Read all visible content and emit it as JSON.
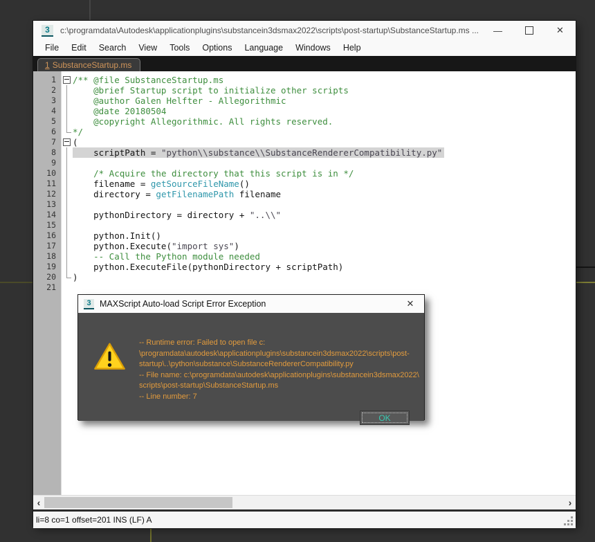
{
  "window": {
    "title": "c:\\programdata\\Autodesk\\applicationplugins\\substancein3dsmax2022\\scripts\\post-startup\\SubstanceStartup.ms ...",
    "minimize_glyph": "—",
    "close_glyph": "✕"
  },
  "icons": {
    "max_logo": "3"
  },
  "menu": {
    "items": [
      "File",
      "Edit",
      "Search",
      "View",
      "Tools",
      "Options",
      "Language",
      "Windows",
      "Help"
    ]
  },
  "tabs": [
    {
      "index": "1",
      "label": "SubstanceStartup.ms",
      "active": true
    }
  ],
  "editor": {
    "lines": [
      {
        "n": 1,
        "fold": "box",
        "hl": false,
        "segments": [
          {
            "c": "comment",
            "t": "/** @file SubstanceStartup.ms"
          }
        ]
      },
      {
        "n": 2,
        "fold": "line",
        "hl": false,
        "segments": [
          {
            "c": "comment",
            "t": "    @brief Startup script to initialize other scripts"
          }
        ]
      },
      {
        "n": 3,
        "fold": "line",
        "hl": false,
        "segments": [
          {
            "c": "comment",
            "t": "    @author Galen Helfter - Allegorithmic"
          }
        ]
      },
      {
        "n": 4,
        "fold": "line",
        "hl": false,
        "segments": [
          {
            "c": "comment",
            "t": "    @date 20180504"
          }
        ]
      },
      {
        "n": 5,
        "fold": "line",
        "hl": false,
        "segments": [
          {
            "c": "comment",
            "t": "    @copyright Allegorithmic. All rights reserved."
          }
        ]
      },
      {
        "n": 6,
        "fold": "end",
        "hl": false,
        "segments": [
          {
            "c": "comment",
            "t": "*/"
          }
        ]
      },
      {
        "n": 7,
        "fold": "box",
        "hl": false,
        "segments": [
          {
            "c": "code",
            "t": "("
          }
        ]
      },
      {
        "n": 8,
        "fold": "line",
        "hl": true,
        "segments": [
          {
            "c": "code",
            "t": "    scriptPath = "
          },
          {
            "c": "string",
            "t": "\"python\\\\substance\\\\SubstanceRendererCompatibility.py\""
          }
        ]
      },
      {
        "n": 9,
        "fold": "line",
        "hl": false,
        "segments": []
      },
      {
        "n": 10,
        "fold": "line",
        "hl": false,
        "segments": [
          {
            "c": "code",
            "t": "    "
          },
          {
            "c": "comment",
            "t": "/* Acquire the directory that this script is in */"
          }
        ]
      },
      {
        "n": 11,
        "fold": "line",
        "hl": false,
        "segments": [
          {
            "c": "code",
            "t": "    filename = "
          },
          {
            "c": "func",
            "t": "getSourceFileName"
          },
          {
            "c": "code",
            "t": "()"
          }
        ]
      },
      {
        "n": 12,
        "fold": "line",
        "hl": false,
        "segments": [
          {
            "c": "code",
            "t": "    directory = "
          },
          {
            "c": "func",
            "t": "getFilenamePath"
          },
          {
            "c": "code",
            "t": " filename"
          }
        ]
      },
      {
        "n": 13,
        "fold": "line",
        "hl": false,
        "segments": []
      },
      {
        "n": 14,
        "fold": "line",
        "hl": false,
        "segments": [
          {
            "c": "code",
            "t": "    pythonDirectory = directory + "
          },
          {
            "c": "string",
            "t": "\"..\\\\\""
          }
        ]
      },
      {
        "n": 15,
        "fold": "line",
        "hl": false,
        "segments": []
      },
      {
        "n": 16,
        "fold": "line",
        "hl": false,
        "segments": [
          {
            "c": "code",
            "t": "    python.Init()"
          }
        ]
      },
      {
        "n": 17,
        "fold": "line",
        "hl": false,
        "segments": [
          {
            "c": "code",
            "t": "    python.Execute("
          },
          {
            "c": "string",
            "t": "\"import sys\""
          },
          {
            "c": "code",
            "t": ")"
          }
        ]
      },
      {
        "n": 18,
        "fold": "line",
        "hl": false,
        "segments": [
          {
            "c": "code",
            "t": "    "
          },
          {
            "c": "comment",
            "t": "-- Call the Python module needed"
          }
        ]
      },
      {
        "n": 19,
        "fold": "line",
        "hl": false,
        "segments": [
          {
            "c": "code",
            "t": "    python.ExecuteFile(pythonDirectory + scriptPath)"
          }
        ]
      },
      {
        "n": 20,
        "fold": "end",
        "hl": false,
        "segments": [
          {
            "c": "code",
            "t": ")"
          }
        ]
      },
      {
        "n": 21,
        "fold": "none",
        "hl": false,
        "segments": []
      }
    ]
  },
  "scrollbar": {
    "left_glyph": "‹",
    "right_glyph": "›"
  },
  "status_bar": {
    "text": "li=8 co=1 offset=201 INS (LF) A"
  },
  "dialog": {
    "title": "MAXScript Auto-load Script Error Exception",
    "message_lines": [
      "-- Runtime error: Failed to open file c:",
      "\\programdata\\autodesk\\applicationplugins\\substancein3dsmax2022\\scripts\\post-",
      "startup\\..\\python\\substance\\SubstanceRendererCompatibility.py",
      "-- File name: c:\\programdata\\autodesk\\applicationplugins\\substancein3dsmax2022\\",
      "scripts\\post-startup\\SubstanceStartup.ms",
      "-- Line number: 7"
    ],
    "ok_label": "OK"
  },
  "colors": {
    "comment_green": "#3e8e3e",
    "function_teal": "#2f97ab",
    "string_slate": "#4a4752",
    "line_highlight": "#d4d4d4",
    "tab_text_orange": "#d0955a",
    "dialog_text_orange": "#e29b3d",
    "warning_yellow": "#ffd21e",
    "ok_teal": "#39c9b2",
    "dialog_body_gray": "#4c4c4c",
    "desktop_gray": "#313131"
  }
}
